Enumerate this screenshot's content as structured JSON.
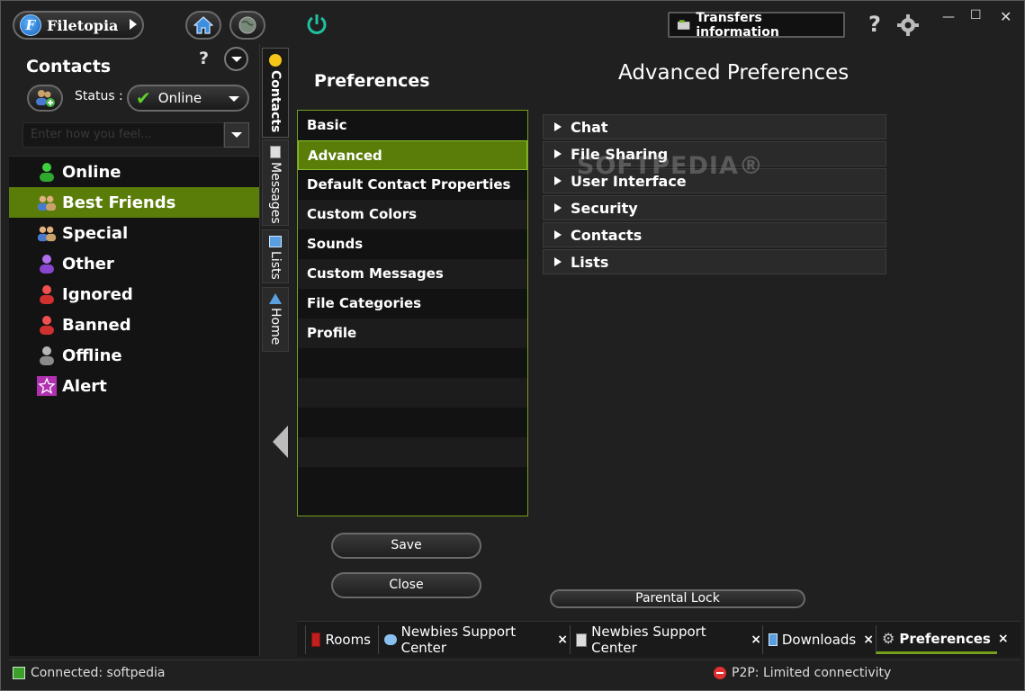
{
  "app": {
    "name": "Filetopia",
    "transfers_button": "Transfers information",
    "help_icon": "help-icon",
    "settings_icon": "gear-icon"
  },
  "contacts_panel": {
    "title": "Contacts",
    "help": "?",
    "status_label": "Status :",
    "status_value": "Online",
    "feel_placeholder": "Enter how you feel...",
    "groups": [
      {
        "label": "Online",
        "icon": "user-green-icon",
        "color": "#3fcf3f"
      },
      {
        "label": "Best Friends",
        "icon": "users-group-icon",
        "color": "#c9a16b"
      },
      {
        "label": "Special",
        "icon": "users-group-icon",
        "color": "#c9a16b"
      },
      {
        "label": "Other",
        "icon": "user-purple-icon",
        "color": "#a35be0"
      },
      {
        "label": "Ignored",
        "icon": "user-red-icon",
        "color": "#e03a3a"
      },
      {
        "label": "Banned",
        "icon": "user-red-icon",
        "color": "#e03a3a"
      },
      {
        "label": "Offline",
        "icon": "user-gray-icon",
        "color": "#9a9a9a"
      },
      {
        "label": "Alert",
        "icon": "star-icon",
        "color": "#c040c0"
      }
    ]
  },
  "side_tabs": [
    "Contacts",
    "Messages",
    "Lists",
    "Home"
  ],
  "preferences": {
    "title": "Preferences",
    "items": [
      "Basic",
      "Advanced",
      "Default Contact Properties",
      "Custom Colors",
      "Sounds",
      "Custom Messages",
      "File Categories",
      "Profile"
    ],
    "save": "Save",
    "close": "Close"
  },
  "advanced": {
    "title": "Advanced Preferences",
    "sections": [
      "Chat",
      "File Sharing",
      "User Interface",
      "Security",
      "Contacts",
      "Lists"
    ],
    "parental_lock": "Parental Lock",
    "watermark": "SOFTPEDIA®"
  },
  "bottom_tabs": [
    {
      "label": "Rooms",
      "icon": "book-icon",
      "close": ""
    },
    {
      "label": "Newbies Support Center",
      "icon": "chat-icon",
      "close": "×"
    },
    {
      "label": "Newbies Support Center",
      "icon": "document-icon",
      "close": "×"
    },
    {
      "label": "Downloads",
      "icon": "window-icon",
      "close": "×"
    },
    {
      "label": "Preferences",
      "icon": "gear-icon",
      "close": "×"
    }
  ],
  "statusbar": {
    "connected": "Connected: softpedia",
    "p2p": "P2P: Limited connectivity"
  },
  "colors": {
    "accent": "#5a7d0a",
    "accent_border": "#74a01c"
  }
}
